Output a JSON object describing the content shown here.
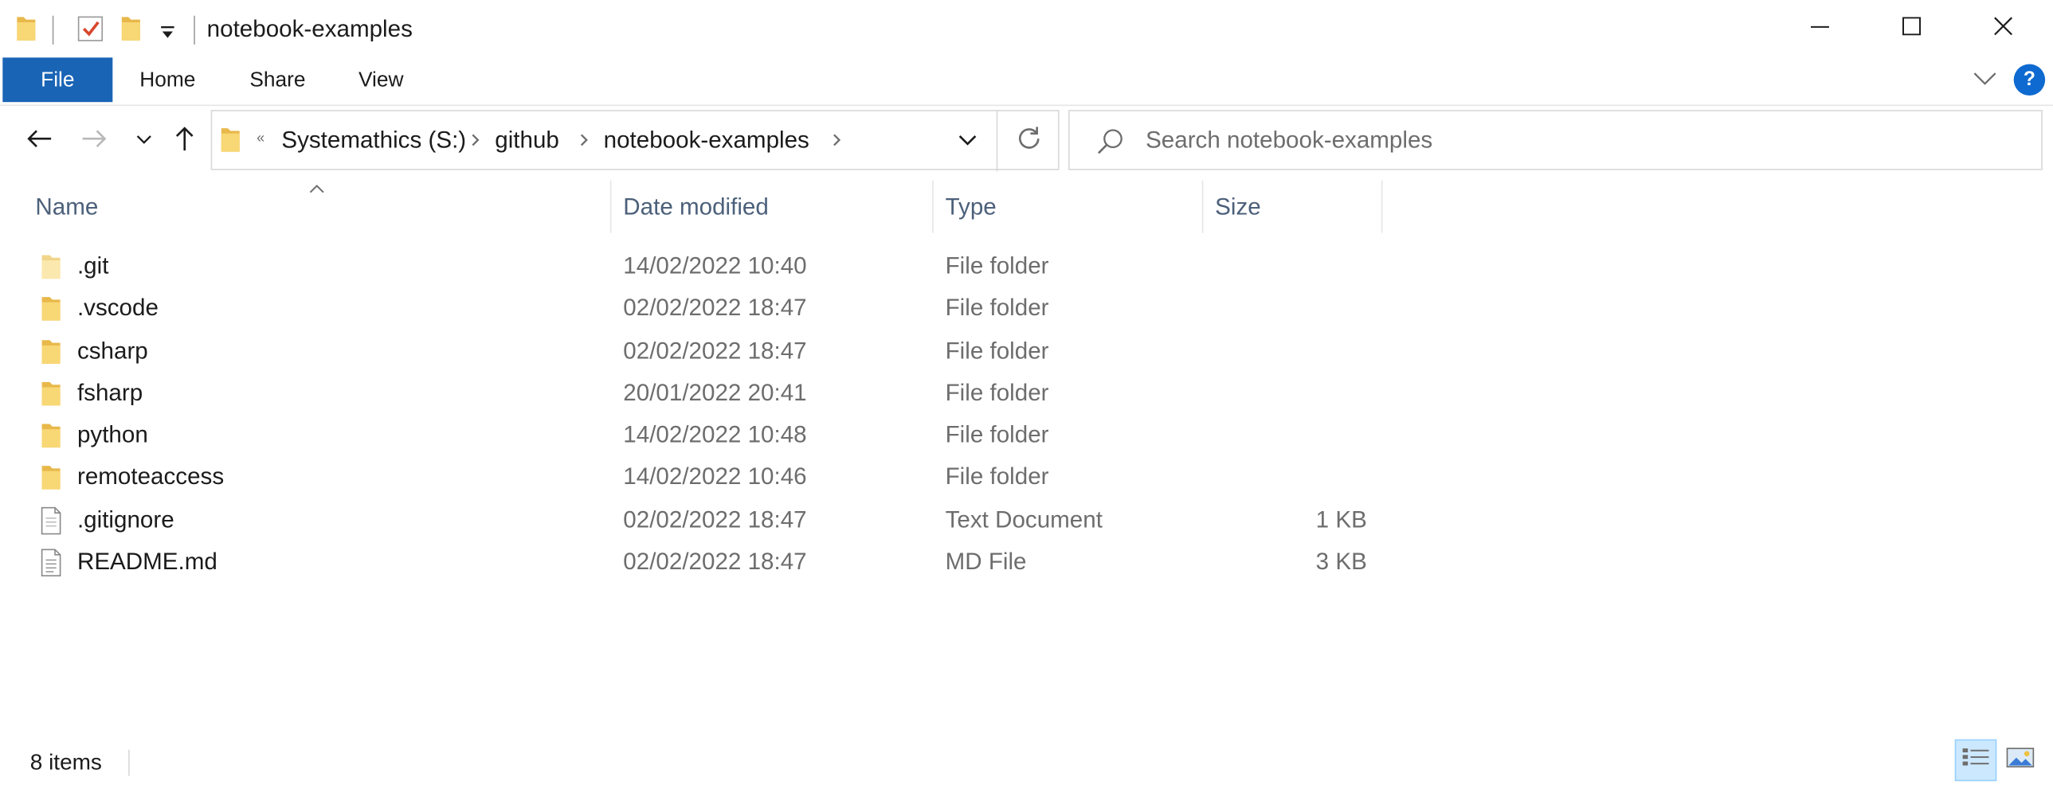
{
  "window": {
    "title": "notebook-examples"
  },
  "ribbon": {
    "tabs": [
      "File",
      "Home",
      "Share",
      "View"
    ],
    "help_label": "?"
  },
  "address": {
    "overflow_chevron": "«",
    "crumbs": [
      "Systemathics (S:)",
      "github",
      "notebook-examples"
    ]
  },
  "search": {
    "placeholder": "Search notebook-examples"
  },
  "columns": {
    "name": "Name",
    "date": "Date modified",
    "type": "Type",
    "size": "Size"
  },
  "files": [
    {
      "name": ".git",
      "date": "14/02/2022 10:40",
      "type": "File folder",
      "size": "",
      "icon": "folder-light-icon"
    },
    {
      "name": ".vscode",
      "date": "02/02/2022 18:47",
      "type": "File folder",
      "size": "",
      "icon": "folder-icon"
    },
    {
      "name": "csharp",
      "date": "02/02/2022 18:47",
      "type": "File folder",
      "size": "",
      "icon": "folder-icon"
    },
    {
      "name": "fsharp",
      "date": "20/01/2022 20:41",
      "type": "File folder",
      "size": "",
      "icon": "folder-icon"
    },
    {
      "name": "python",
      "date": "14/02/2022 10:48",
      "type": "File folder",
      "size": "",
      "icon": "folder-icon"
    },
    {
      "name": "remoteaccess",
      "date": "14/02/2022 10:46",
      "type": "File folder",
      "size": "",
      "icon": "folder-icon"
    },
    {
      "name": ".gitignore",
      "date": "02/02/2022 18:47",
      "type": "Text Document",
      "size": "1 KB",
      "icon": "text-file-icon"
    },
    {
      "name": "README.md",
      "date": "02/02/2022 18:47",
      "type": "MD File",
      "size": "3 KB",
      "icon": "md-file-icon"
    }
  ],
  "status": {
    "item_count": "8 items"
  },
  "colors": {
    "accent": "#1a64b6",
    "folder": "#f8d775",
    "header_text": "#4c607a",
    "secondary_text": "#6d6d6d"
  }
}
